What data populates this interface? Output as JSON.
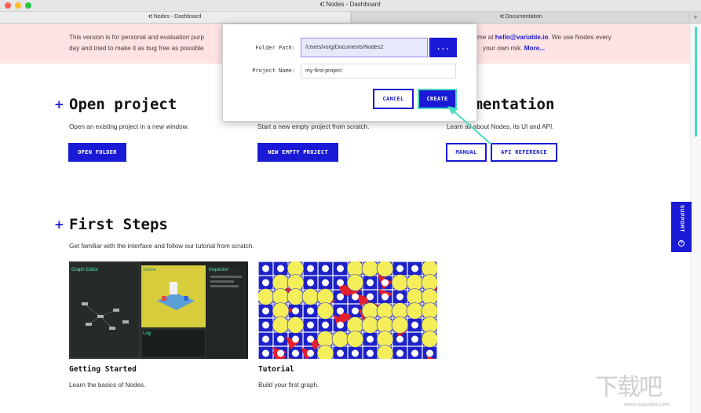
{
  "window": {
    "title": "Nodes - Dashboard"
  },
  "tabs": [
    {
      "label": "Nodes - Dashboard"
    },
    {
      "label": "Documentation"
    }
  ],
  "tab_plus": "+",
  "banner": {
    "line1_start": "This version is for personal and evaluation purp",
    "line1_end": "me at ",
    "email": "hello@variable.io",
    "line1_tail": ". We use Nodes every",
    "line2_start": "day and tried to make it as bug free as possible",
    "line2_end": "your own risk. ",
    "more": "More..."
  },
  "sections": {
    "open": {
      "plus": "+",
      "title": "Open project",
      "desc": "Open an existing project in a new window.",
      "button": "OPEN FOLDER"
    },
    "new": {
      "desc": "Start a new empty project from scratch.",
      "button": "NEW EMPTY PROJECT"
    },
    "docs": {
      "title": "umentation",
      "desc": "Learn all about Nodes, its UI and API.",
      "btn_manual": "MANUAL",
      "btn_api": "API REFERENCE"
    },
    "first_steps": {
      "plus": "+",
      "title": "First Steps",
      "desc": "Get familiar with the interface and follow our tutorial from scratch.",
      "cards": [
        {
          "title": "Getting Started",
          "desc": "Learn the basics of Nodes.",
          "panels": [
            "Graph Editor",
            "Scene",
            "Inspector",
            "Log"
          ]
        },
        {
          "title": "Tutorial",
          "desc": "Build your first graph."
        }
      ]
    }
  },
  "support": {
    "label": "SUPPORT",
    "icon": "help-circle-icon"
  },
  "dialog": {
    "folder_label": "Folder Path:",
    "folder_value": "/Users/vorg/Documents/Nodes2",
    "browse_label": "...",
    "name_label": "Project Name:",
    "name_value": "my-first-project",
    "cancel_label": "CANCEL",
    "create_label": "CREATE"
  },
  "watermark": {
    "text": "下载吧",
    "url": "www.xiazaiba.com"
  },
  "colors": {
    "accent": "#1a1ad6",
    "banner": "#fde3e3",
    "highlight": "#4ddbc1",
    "yellow": "#f3ee5a",
    "red": "#e5202a"
  }
}
